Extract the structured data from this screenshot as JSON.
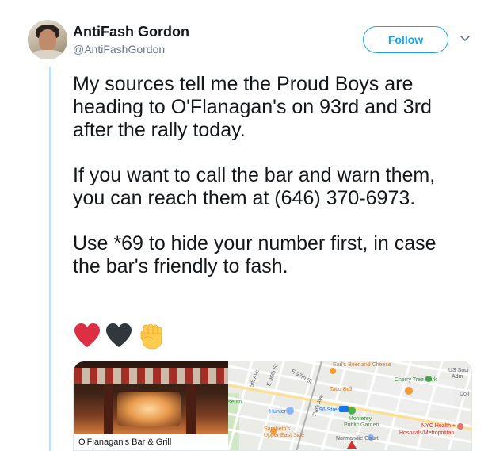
{
  "author": {
    "display_name": "AntiFash Gordon",
    "handle": "@AntiFashGordon"
  },
  "actions": {
    "follow_label": "Follow"
  },
  "tweet": {
    "paragraphs": [
      "My sources tell me the Proud Boys are heading to O'Flanagan's on 93rd and 3rd after the rally today.",
      "If you want to call the bar and warn them, you can reach them at (646) 370-6973.",
      "Use *69 to hide your number first, in case the bar's friendly to fash."
    ],
    "emojis": [
      "red-heart",
      "black-heart",
      "raised-fist"
    ]
  },
  "card": {
    "caption": "O'Flanagan's Bar & Grill",
    "map_labels": {
      "earls": "Earl's Beer and Cheese",
      "us_soc": "US Soci",
      "adm": "Adm",
      "cherry": "Cherry Tree Park",
      "taco": "Taco Bell",
      "doll": "Doll",
      "hunter": "Hunter",
      "station": "96 Street",
      "monterey": "Monterey",
      "public_garden": "Public Garden",
      "sarabeths": "Sarabeth's",
      "upper_east": "Upper East Side",
      "normandie": "Normandie Court",
      "nyc_health": "NYC Health +",
      "hospitals": "Hospitals/Metropolitan",
      "seum": "seum",
      "e96": "E 96th St",
      "e97": "E 97th St",
      "park_ave": "Park Ave",
      "fifth_ave": "5th Ave"
    }
  },
  "colors": {
    "accent": "#1da1f2",
    "thread_line": "#c4e2f7",
    "text": "#14171a",
    "secondary": "#657786"
  }
}
